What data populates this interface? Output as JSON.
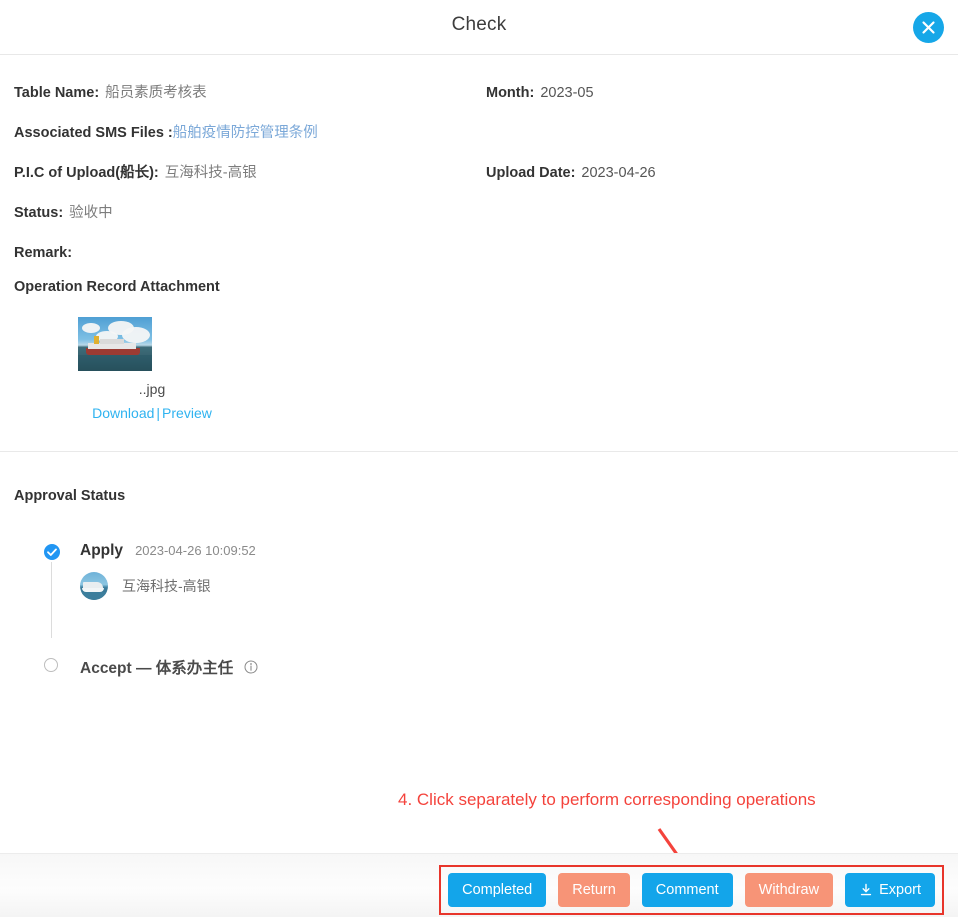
{
  "header": {
    "title": "Check",
    "close_icon": "close-icon"
  },
  "details": {
    "rows": [
      {
        "label": "Table Name:",
        "value": "船员素质考核表",
        "right_label": "Month:",
        "right_value": "2023-05"
      },
      {
        "label": "Associated SMS Files :",
        "link_value": "船舶疫情防控管理条例",
        "right_label": "",
        "right_value": ""
      },
      {
        "label": "P.I.C of Upload(船长):",
        "value": "互海科技-高银",
        "right_label": "Upload Date:",
        "right_value": "2023-04-26"
      },
      {
        "label": "Status:",
        "value": "验收中",
        "right_label": "",
        "right_value": ""
      },
      {
        "label": "Remark:",
        "value": "",
        "right_label": "",
        "right_value": ""
      }
    ]
  },
  "attachment": {
    "section_title": "Operation Record Attachment",
    "thumbnail_icon": "ship-photo-thumbnail",
    "filename": "..jpg",
    "download_label": "Download",
    "separator": "|",
    "preview_label": "Preview"
  },
  "approval": {
    "section_title": "Approval Status",
    "steps": [
      {
        "name": "Apply",
        "time": "2023-04-26 10:09:52",
        "user": "互海科技-高银",
        "state": "done"
      },
      {
        "name": "Accept — 体系办主任",
        "time": "",
        "user": "",
        "state": "pending",
        "info_icon": "info-circle-icon"
      }
    ]
  },
  "annotation": {
    "text": "4. Click separately to perform corresponding operations",
    "color": "#f4433c",
    "arrow_icon": "arrow-down-right-icon"
  },
  "footer": {
    "buttons": [
      {
        "label": "Completed",
        "color": "#13a5ea",
        "style": "blue"
      },
      {
        "label": "Return",
        "color": "#f79477",
        "style": "salmon"
      },
      {
        "label": "Comment",
        "color": "#13a5ea",
        "style": "blue"
      },
      {
        "label": "Withdraw",
        "color": "#f79477",
        "style": "salmon"
      },
      {
        "label": "Export",
        "color": "#13a5ea",
        "style": "blue",
        "icon": "download-icon"
      }
    ],
    "highlight_color": "#e8352b"
  }
}
